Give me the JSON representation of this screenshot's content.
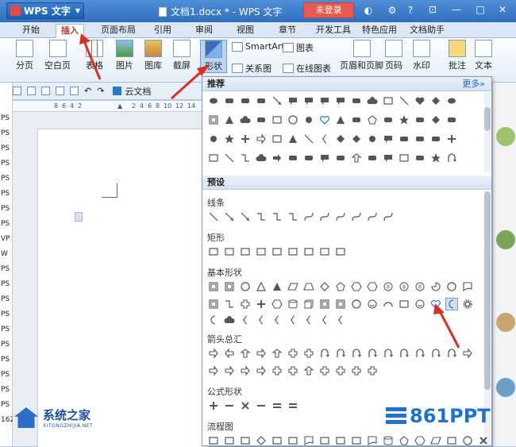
{
  "titlebar": {
    "app_button": "WPS 文字",
    "document_title": "文档1.docx * - WPS 文字",
    "login": "未登录"
  },
  "menu": {
    "tabs": [
      "开始",
      "插入",
      "页面布局",
      "引用",
      "审阅",
      "视图",
      "章节",
      "开发工具",
      "特色应用",
      "文档助手"
    ],
    "active_tab": "插入"
  },
  "ribbon": {
    "page_break": "分页",
    "blank_page": "空白页",
    "table": "表格",
    "picture": "图片",
    "gallery": "图库",
    "screenshot": "截屏",
    "shapes": "形状",
    "smartart": "SmartArt",
    "chart": "图表",
    "relation_chart": "关系图",
    "online_chart": "在线图表",
    "header_footer": "页眉和页脚",
    "page_number": "页码",
    "watermark": "水印",
    "comment": "批注",
    "textbox": "文本"
  },
  "quickbar": {
    "cloud_doc": "云文档"
  },
  "shapes_panel": {
    "recommended": "推荐",
    "more": "更多»",
    "presets": "预设",
    "categories": [
      "线条",
      "矩形",
      "基本形状",
      "箭头总汇",
      "公式形状",
      "流程图"
    ]
  },
  "left_strip_labels": [
    "PS",
    "PS",
    "PS",
    "PS",
    "PS",
    "PS",
    "PS",
    "PS",
    "VP",
    "W",
    "PS",
    "PS",
    "PS",
    "PS",
    "PS",
    "PS",
    "PS",
    "PS",
    "PS",
    "PS",
    "162"
  ],
  "watermarks": {
    "left_text": "系统之家",
    "left_sub": "XITONGZHIJIA.NET",
    "right_text": "861PPT"
  },
  "colors": {
    "titlebar": "#2f6fbf",
    "active_tab_text": "#c0392b",
    "login_button": "#e85a4f",
    "arrow": "#d93025"
  }
}
